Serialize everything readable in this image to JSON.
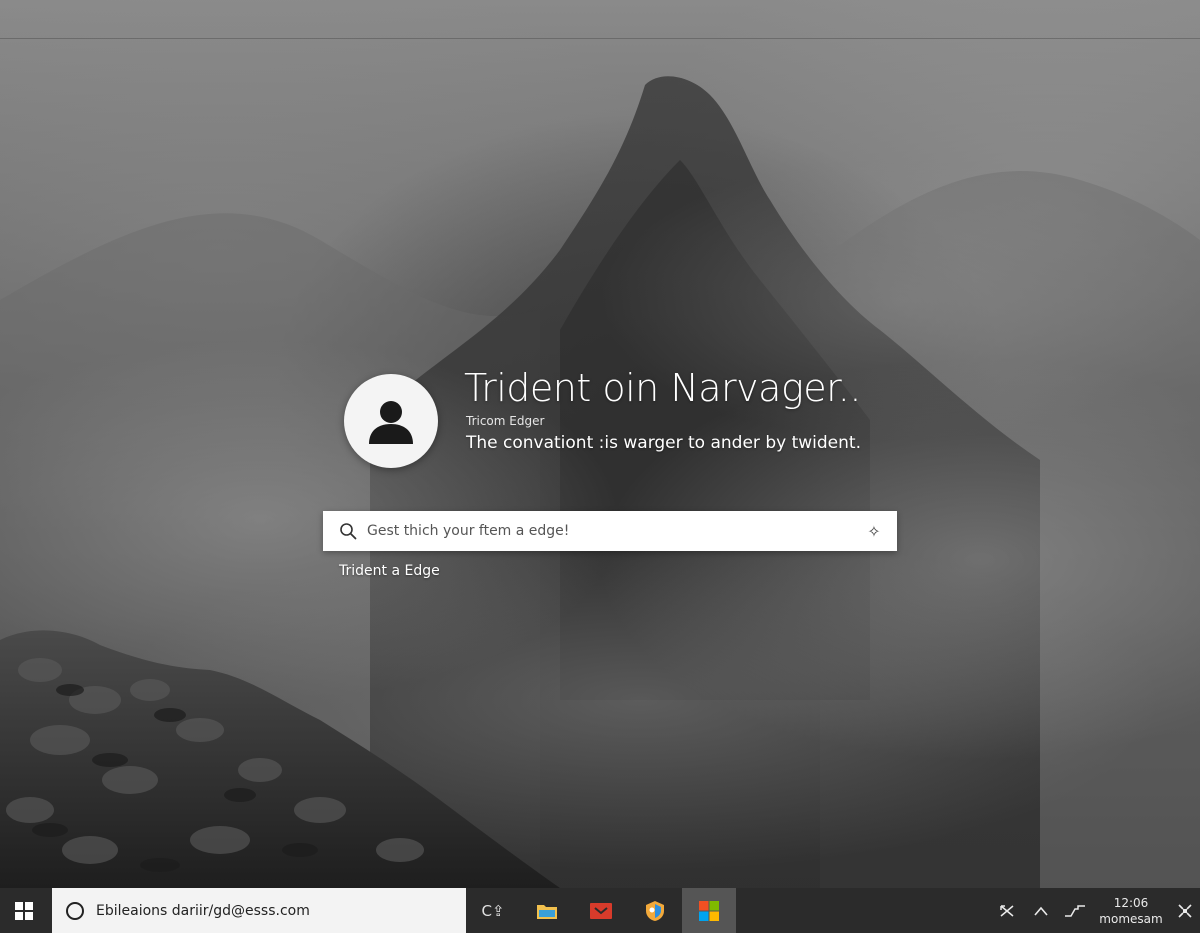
{
  "lock_screen": {
    "title": "Trident oin Narvager..",
    "subtitle": "Tricom Edger",
    "description": "The convationt :is warger to ander by twident.",
    "search": {
      "placeholder": "Gest thich your ftem a edge!"
    },
    "below_label": "Trident a Edge"
  },
  "taskbar": {
    "search_text": "Ebileaions dariir/gd@esss.com",
    "task_view_label": "C⇪",
    "clock": {
      "time": "12:06",
      "date": "momesam"
    }
  },
  "icons": {
    "avatar": "user-icon",
    "search": "search-icon",
    "search_action": "sparkle-icon",
    "start": "windows-logo-icon",
    "file_explorer": "folder-icon",
    "app_red": "red-app-icon",
    "app_shield": "shield-app-icon",
    "app_store": "store-icon",
    "tray_network": "network-icon",
    "tray_chevron": "chevron-up-icon",
    "tray_pen": "pen-icon",
    "notifications": "notification-icon"
  },
  "colors": {
    "taskbar": "#2b2b2b",
    "taskbar_search": "#f3f3f3",
    "active_app": "#555555",
    "text_light": "#ffffff"
  }
}
